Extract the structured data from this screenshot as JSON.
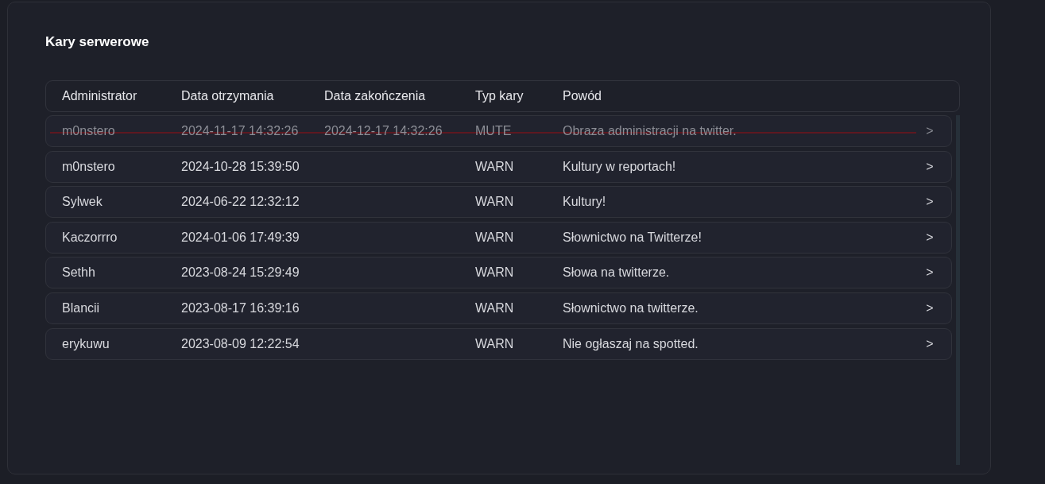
{
  "title": "Kary serwerowe",
  "table": {
    "columns": [
      "Administrator",
      "Data otrzymania",
      "Data zakończenia",
      "Typ kary",
      "Powód"
    ],
    "rows": [
      {
        "cells": [
          "m0nstero",
          "2024-11-17 14:32:26",
          "2024-12-17 14:32:26",
          "MUTE",
          "Obraza administracji na twitter."
        ],
        "revoked": true,
        "chevron": ">"
      },
      {
        "cells": [
          "m0nstero",
          "2024-10-28 15:39:50",
          "",
          "WARN",
          "Kultury w reportach!"
        ],
        "revoked": false,
        "chevron": ">"
      },
      {
        "cells": [
          "Sylwek",
          "2024-06-22 12:32:12",
          "",
          "WARN",
          "Kultury!"
        ],
        "revoked": false,
        "chevron": ">"
      },
      {
        "cells": [
          "Kaczorrro",
          "2024-01-06 17:49:39",
          "",
          "WARN",
          "Słownictwo na Twitterze!"
        ],
        "revoked": false,
        "chevron": ">"
      },
      {
        "cells": [
          "Sethh",
          "2023-08-24 15:29:49",
          "",
          "WARN",
          "Słowa na twitterze."
        ],
        "revoked": false,
        "chevron": ">"
      },
      {
        "cells": [
          "Blancii",
          "2023-08-17 16:39:16",
          "",
          "WARN",
          "Słownictwo na twitterze."
        ],
        "revoked": false,
        "chevron": ">"
      },
      {
        "cells": [
          "erykuwu",
          "2023-08-09 12:22:54",
          "",
          "WARN",
          "Nie ogłaszaj na spotted."
        ],
        "revoked": false,
        "chevron": ">"
      }
    ]
  }
}
